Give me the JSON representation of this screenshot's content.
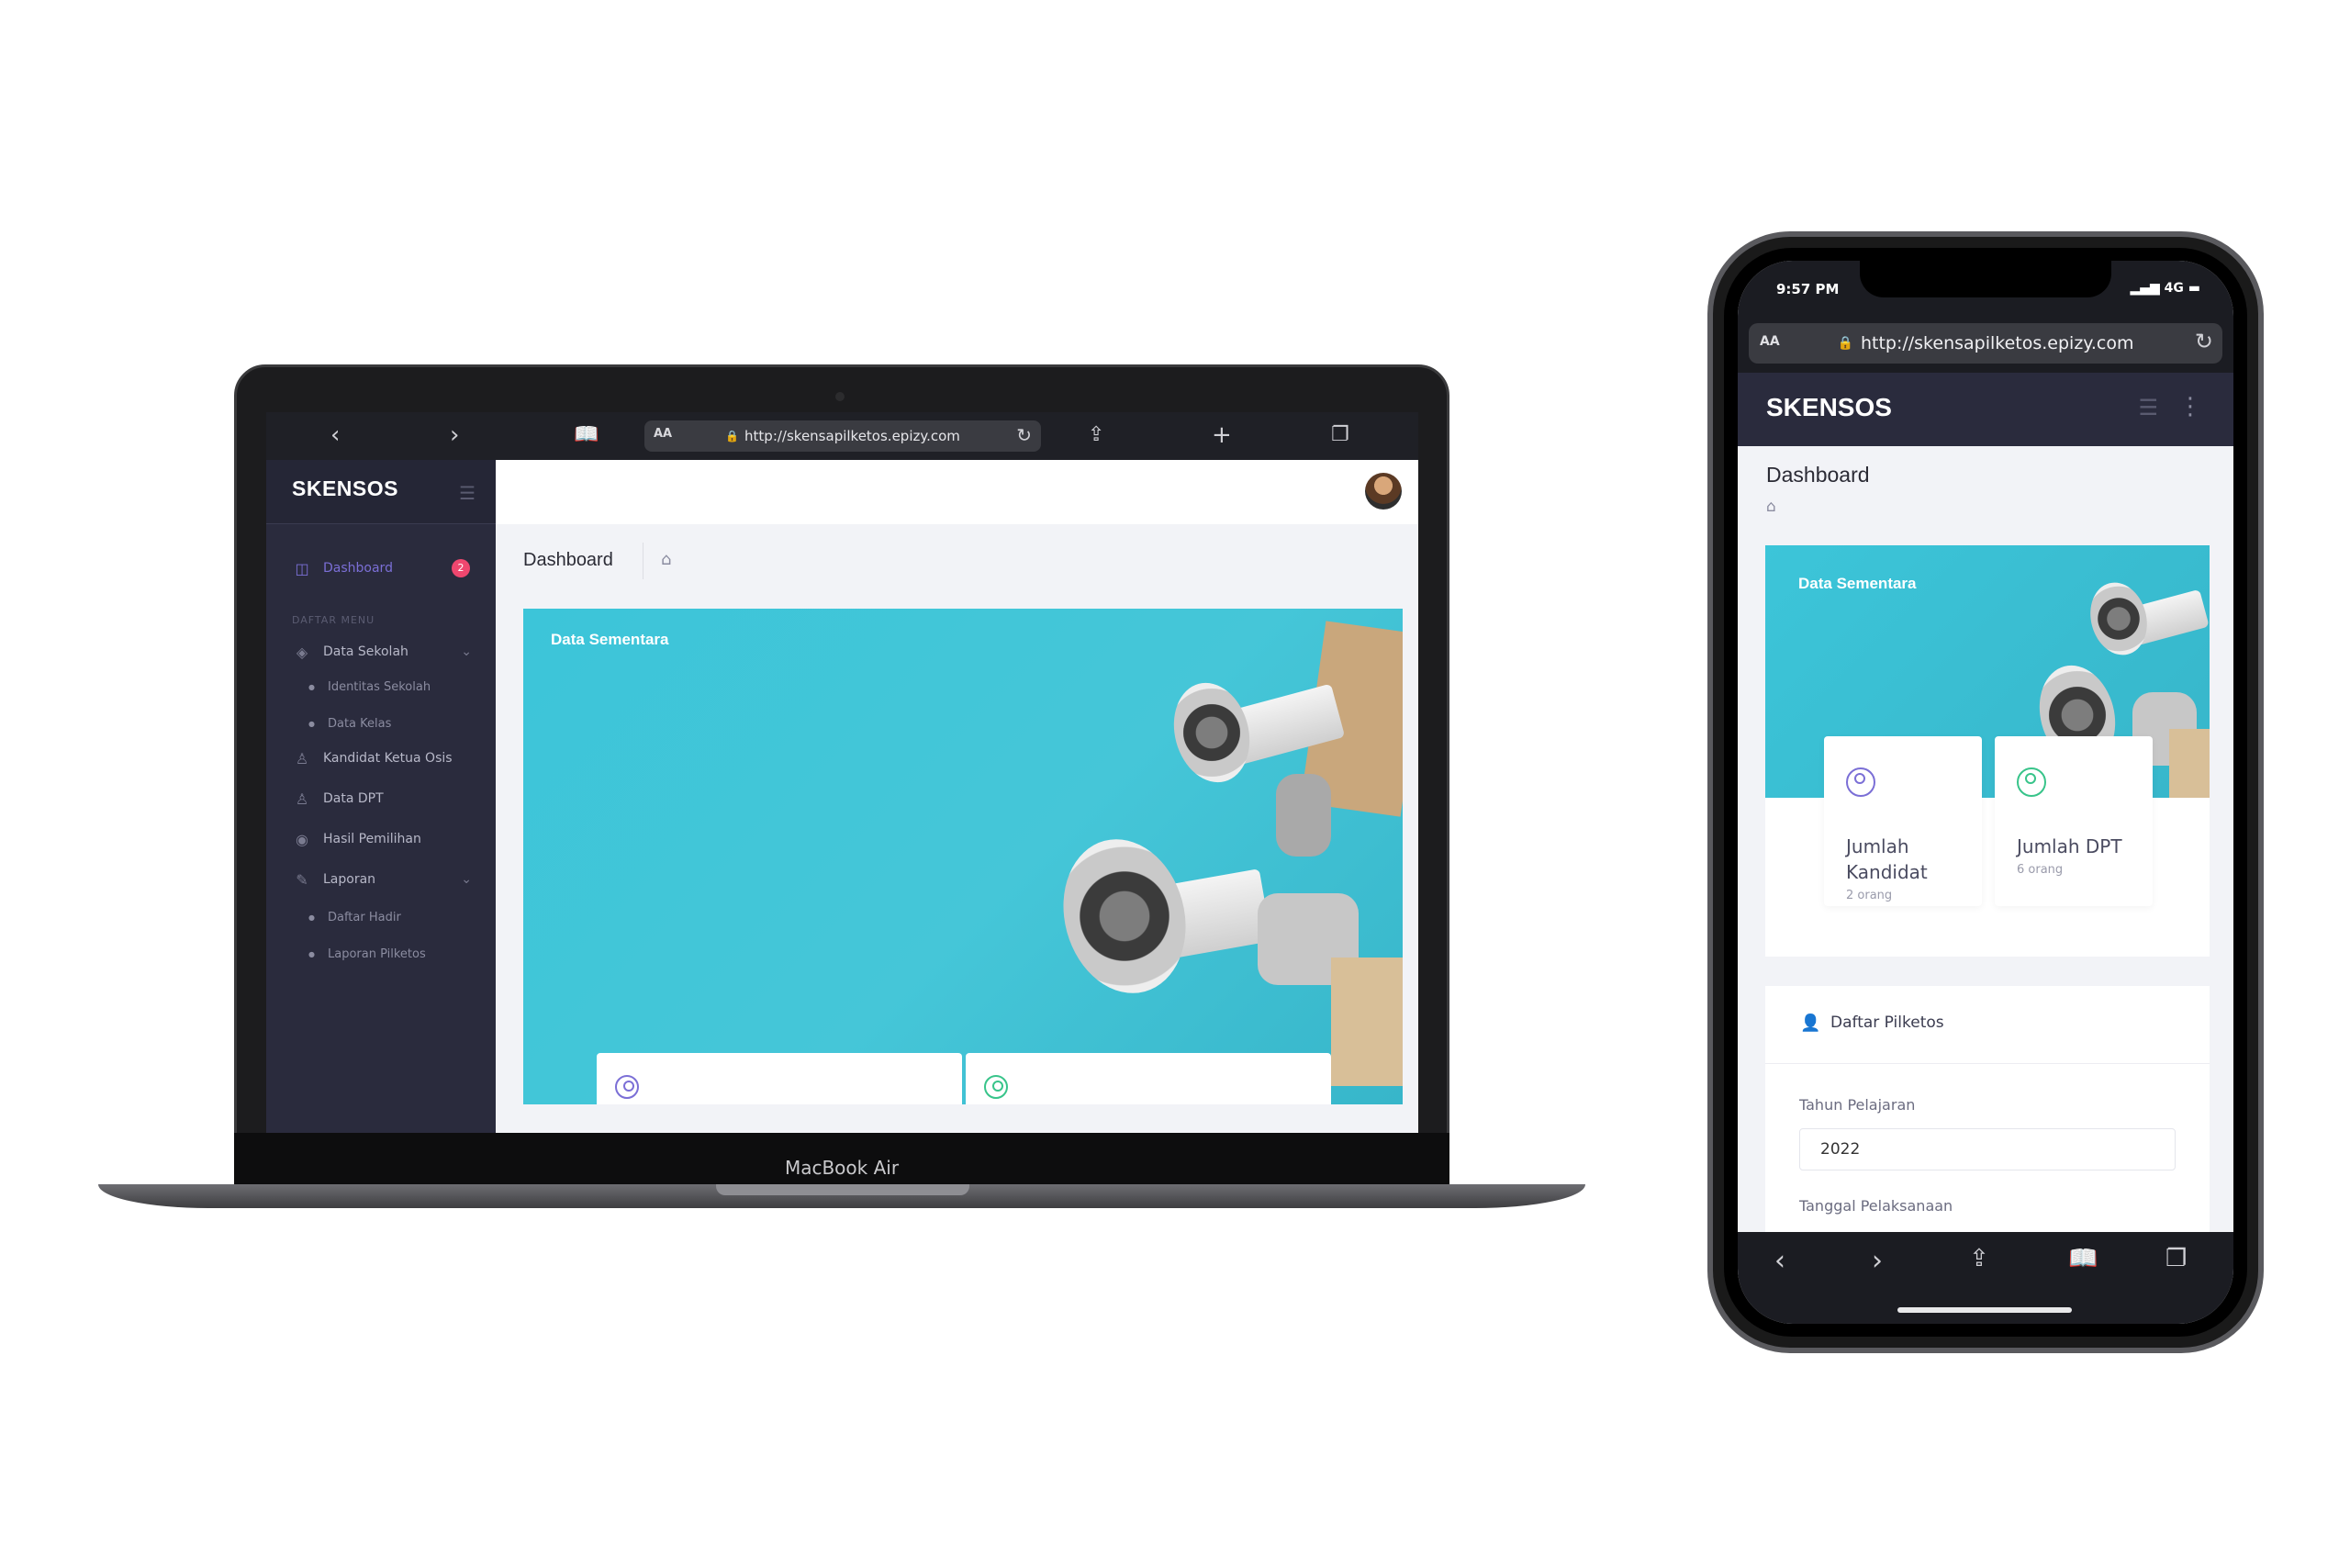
{
  "desktop": {
    "device_label": "MacBook Air",
    "browser": {
      "aa_label": "AA",
      "url": "http://skensapilketos.epizy.com",
      "back_icon": "chevron-left-icon",
      "forward_icon": "chevron-right-icon"
    },
    "app": {
      "logo": "SKENSOS",
      "page_title": "Dashboard",
      "sidebar": {
        "dashboard_label": "Dashboard",
        "dashboard_badge": "2",
        "section_label": "DAFTAR MENU",
        "items": [
          {
            "label": "Data Sekolah",
            "icon": "layers-icon"
          },
          {
            "label": "Identitas Sekolah"
          },
          {
            "label": "Data Kelas"
          },
          {
            "label": "Kandidat Ketua Osis",
            "icon": "user-icon"
          },
          {
            "label": "Data DPT",
            "icon": "user-icon"
          },
          {
            "label": "Hasil Pemilihan",
            "icon": "eye-icon"
          },
          {
            "label": "Laporan",
            "icon": "paperclip-icon"
          },
          {
            "label": "Daftar Hadir"
          },
          {
            "label": "Laporan Pilketos"
          }
        ]
      },
      "banner_label": "Data Sementara"
    }
  },
  "mobile": {
    "status": {
      "time": "9:57 PM",
      "signal": "4G"
    },
    "browser": {
      "aa_label": "AA",
      "url": "http://skensapilketos.epizy.com"
    },
    "app": {
      "logo": "SKENSOS",
      "page_title": "Dashboard",
      "banner_label": "Data Sementara",
      "cards": [
        {
          "title_line1": "Jumlah",
          "title_line2": "Kandidat",
          "sub": "2 orang",
          "color": "#7b6fd6"
        },
        {
          "title_line1": "Jumlah DPT",
          "sub": "6 orang",
          "color": "#38c48a"
        }
      ],
      "form": {
        "title": "Daftar Pilketos",
        "year_label": "Tahun Pelajaran",
        "year_value": "2022",
        "date_label": "Tanggal Pelaksanaan"
      }
    }
  },
  "colors": {
    "sidebar": "#2a2b3d",
    "banner": "#3cc5d9",
    "badge": "#ef476f",
    "accent": "#7b6fd6"
  }
}
